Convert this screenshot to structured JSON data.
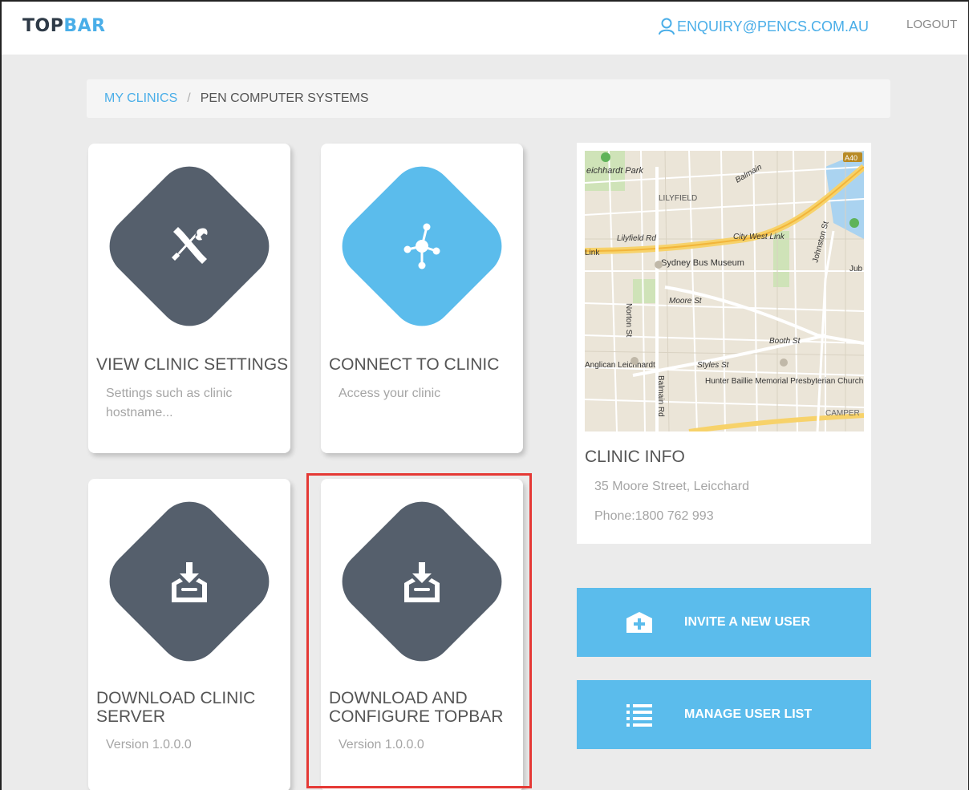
{
  "header": {
    "logo_part1": "TOP",
    "logo_part2": "BAR",
    "user_email": "ENQUIRY@PENCS.COM.AU",
    "logout_label": "LOGOUT"
  },
  "breadcrumb": {
    "root": "MY CLINICS",
    "separator": "/",
    "current": "PEN COMPUTER SYSTEMS"
  },
  "cards": [
    {
      "title": "VIEW CLINIC SETTINGS",
      "description": "Settings such as clinic hostname...",
      "icon": "tools-icon",
      "color": "#555f6c"
    },
    {
      "title": "CONNECT TO CLINIC",
      "description": "Access your clinic",
      "icon": "network-icon",
      "color": "#5bbcec"
    },
    {
      "title": "DOWNLOAD CLINIC SERVER",
      "description": "Version 1.0.0.0",
      "icon": "download-icon",
      "color": "#555f6c"
    },
    {
      "title": "DOWNLOAD AND CONFIGURE TOPBAR",
      "description": "Version 1.0.0.0",
      "icon": "download-icon",
      "color": "#555f6c"
    }
  ],
  "clinic_info": {
    "title": "CLINIC INFO",
    "address": "35 Moore Street, Leicchard",
    "phone": "Phone:1800 762 993",
    "map_labels": {
      "park": "eichhardt Park",
      "lilyfield": "LILYFIELD",
      "lilyfield_rd": "Lilyfield Rd",
      "city_west_link": "City West Link",
      "link": "Link",
      "museum": "Sydney Bus Museum",
      "moore_st": "Moore St",
      "norton_st": "Norton St",
      "booth_st": "Booth St",
      "styles_st": "Styles St",
      "johnston_st": "Johnston St",
      "balmain_rd": "Balmain Rd",
      "anglican": "Anglican Leichhardt",
      "church": "Hunter Baillie Memorial Presbyterian Church Annandale",
      "camper": "CAMPER",
      "jub": "Jub",
      "balmain_top": "Balmain",
      "road_badge": "A40"
    }
  },
  "actions": {
    "invite_label": "INVITE A NEW USER",
    "manage_label": "MANAGE USER LIST"
  },
  "colors": {
    "accent": "#5bbcec",
    "dark_tile": "#555f6c",
    "highlight": "#e53935"
  }
}
